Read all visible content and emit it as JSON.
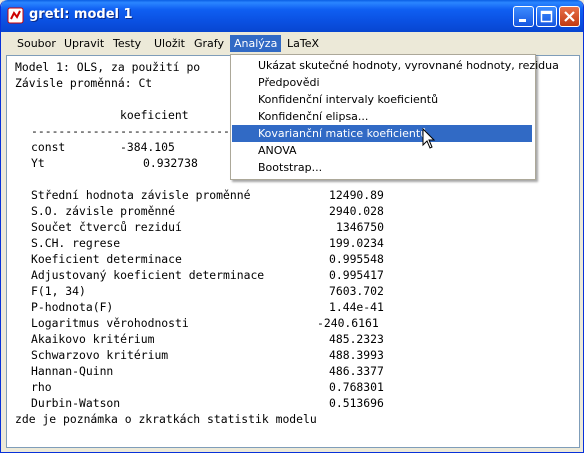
{
  "window": {
    "title": "gretl: model 1",
    "buttons": {
      "minimize": "minimize-button",
      "maximize": "maximize-button",
      "close": "close-button"
    }
  },
  "menubar": {
    "items": [
      {
        "label": "Soubor"
      },
      {
        "label": "Upravit"
      },
      {
        "label": "Testy"
      },
      {
        "label": "Uložit"
      },
      {
        "label": "Grafy"
      },
      {
        "label": "Analýza",
        "active": true
      },
      {
        "label": "LaTeX"
      }
    ]
  },
  "analysis_menu": {
    "items": [
      {
        "label": "Ukázat skutečné hodnoty, vyrovnané hodnoty, rezidua"
      },
      {
        "label": "Předpovědi"
      },
      {
        "label": "Konfidenční intervaly koeficientů"
      },
      {
        "label": "Konfidenční elipsa..."
      },
      {
        "label": "Kovarianční matice koeficientů",
        "highlighted": true
      },
      {
        "label": "ANOVA"
      },
      {
        "label": "Bootstrap..."
      }
    ]
  },
  "output": {
    "header_line1": "Model 1: OLS, za použití po",
    "header_line2": "Závisle proměnná: Ct",
    "col_header": "koeficient",
    "separator": "-----------------------------------------",
    "coefficients": [
      {
        "name": "const",
        "value": "-384.105"
      },
      {
        "name": "Yt",
        "value": "0.932738"
      }
    ],
    "stats": [
      {
        "label": "Střední hodnota závisle proměnné",
        "value": "12490.89"
      },
      {
        "label": "S.O. závisle proměnné",
        "value": "2940.028"
      },
      {
        "label": "Součet čtverců reziduí",
        "value": "1346750"
      },
      {
        "label": "S.CH. regrese",
        "value": "199.0234"
      },
      {
        "label": "Koeficient determinace",
        "value": "0.995548"
      },
      {
        "label": "Adjustovaný koeficient determinace",
        "value": "0.995417"
      },
      {
        "label": "F(1, 34)",
        "value": "7603.702"
      },
      {
        "label": "P-hodnota(F)",
        "value": "1.44e-41"
      },
      {
        "label": "Logaritmus věrohodnosti",
        "value": "-240.6161"
      },
      {
        "label": "Akaikovo kritérium",
        "value": "485.2323"
      },
      {
        "label": "Schwarzovo kritérium",
        "value": "488.3993"
      },
      {
        "label": "Hannan-Quinn",
        "value": "486.3377"
      },
      {
        "label": "rho",
        "value": "0.768301"
      },
      {
        "label": "Durbin-Watson",
        "value": "0.513696"
      }
    ],
    "footer": "zde je poznámka o zkratkách statistik modelu"
  },
  "colors": {
    "titlebar": "#0a4fe0",
    "menu_highlight": "#316ac5",
    "window_bg": "#ece9d8",
    "close_button": "#c23a10"
  }
}
